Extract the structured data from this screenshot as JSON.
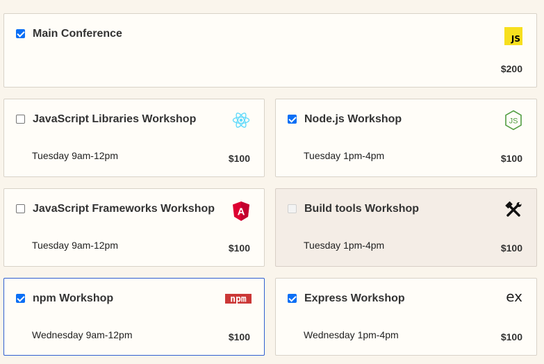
{
  "cards": [
    {
      "title": "Main Conference",
      "time": "",
      "price": "$200",
      "checked": true,
      "icon": "javascript-logo-icon",
      "icon_text": "JS"
    },
    {
      "title": "JavaScript Libraries Workshop",
      "time": "Tuesday 9am-12pm",
      "price": "$100",
      "checked": false,
      "icon": "react-logo-icon"
    },
    {
      "title": "Node.js Workshop",
      "time": "Tuesday 1pm-4pm",
      "price": "$100",
      "checked": true,
      "icon": "nodejs-logo-icon",
      "icon_text": "JS"
    },
    {
      "title": "JavaScript Frameworks Workshop",
      "time": "Tuesday 9am-12pm",
      "price": "$100",
      "checked": false,
      "icon": "angular-logo-icon",
      "icon_text": "A"
    },
    {
      "title": "Build tools Workshop",
      "time": "Tuesday 1pm-4pm",
      "price": "$100",
      "checked": false,
      "disabled": true,
      "icon": "tools-icon"
    },
    {
      "title": "npm Workshop",
      "time": "Wednesday 9am-12pm",
      "price": "$100",
      "checked": true,
      "focused": true,
      "icon": "npm-logo-icon",
      "icon_text": "npm"
    },
    {
      "title": "Express Workshop",
      "time": "Wednesday 1pm-4pm",
      "price": "$100",
      "checked": true,
      "icon": "express-logo-icon",
      "icon_text": "ex"
    }
  ],
  "colors": {
    "background": "#faf5ec",
    "card": "#fffdf8",
    "disabled_card": "#f4ede6",
    "checkbox_accent": "#0b6ff5",
    "focus_border": "#2f5fd0",
    "js_yellow": "#f7df1e",
    "react_blue": "#61dafb",
    "node_green": "#539e43",
    "angular_red": "#dd0031",
    "npm_red": "#cb3837"
  }
}
